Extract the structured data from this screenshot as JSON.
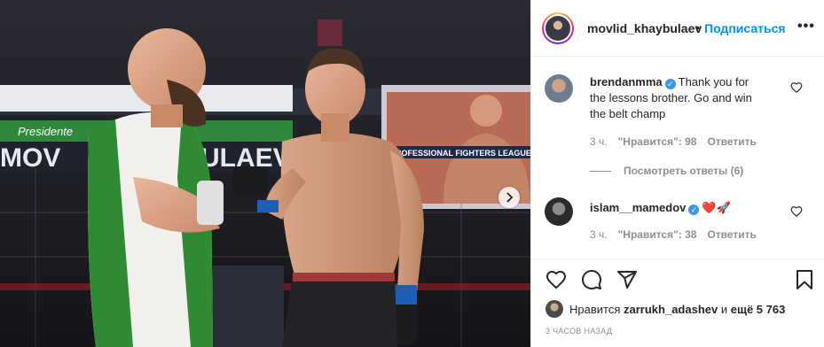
{
  "header": {
    "username": "movlid_khaybulaev",
    "separator": "•",
    "follow_label": "Подписаться",
    "more_label": "•••"
  },
  "photo": {
    "banner_text_left": "MOV",
    "banner_text_mid": "ULAEV",
    "sponsor_text": "Presidente",
    "screen_text": "PROFESSIONAL FIGHTERS LEAGUE",
    "next_arrow": "chevron-right-icon"
  },
  "comments": [
    {
      "username": "brendanmma",
      "verified": true,
      "text_line1": "Thank you for",
      "text_line2": "the lessons brother. Go and win",
      "text_line3": "the belt champ",
      "time": "3 ч.",
      "likes": "\"Нравится\": 98",
      "reply": "Ответить",
      "view_replies": "Посмотреть ответы (6)"
    },
    {
      "username": "islam__mamedov",
      "verified": true,
      "emoji": "❤️🚀",
      "time": "3 ч.",
      "likes": "\"Нравится\": 38",
      "reply": "Ответить"
    }
  ],
  "likes_line": {
    "prefix": "Нравится",
    "user": "zarrukh_adashev",
    "middle": "и",
    "count": "ещё 5 763"
  },
  "timestamp": "3 ЧАСОВ НАЗАД",
  "icons": [
    "heart-icon",
    "comment-icon",
    "share-icon",
    "bookmark-icon"
  ],
  "colors": {
    "link": "#0095f6",
    "verified": "#3897f0",
    "muted": "#8e8e8e",
    "heart": "#ed4956"
  }
}
